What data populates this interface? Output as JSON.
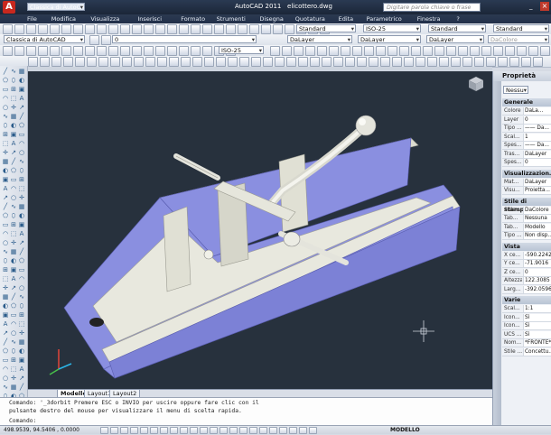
{
  "app": {
    "workspace": "Classica di AutoCAD",
    "title": "AutoCAD 2011",
    "filename": "elicottero.dwg",
    "search_placeholder": "Digitare parola chiave o frase"
  },
  "menu": [
    "File",
    "Modifica",
    "Visualizza",
    "Inserisci",
    "Formato",
    "Strumenti",
    "Disegna",
    "Quotatura",
    "Edita",
    "Parametrico",
    "Finestra",
    "?"
  ],
  "toolbar": {
    "style1": "Standard",
    "dimstyle": "ISO-25",
    "style2": "Standard",
    "style3": "Standard",
    "workspace": "Classica di AutoCAD",
    "layer": "0",
    "color": "DaLayer",
    "linetype": "DaLayer",
    "lineweight": "DaLayer",
    "plotstyle": "DaColore",
    "dimstyle2": "ISO-25"
  },
  "layout_tabs": [
    "Modello",
    "Layout1",
    "Layout2"
  ],
  "command": {
    "line1": "Comando: '_3dorbit Premere ESC o INVIO per uscire oppure fare clic con il",
    "line2": "pulsante destro del mouse per visualizzare il menu di scelta rapida.",
    "prompt": "Comando:"
  },
  "status": {
    "coords": "498.9539, 94.5406 , 0.0000",
    "model": "MODELLO"
  },
  "properties": {
    "title": "Proprietà",
    "selection": "Nessu",
    "sections": [
      {
        "name": "Generale",
        "rows": [
          {
            "k": "Colore",
            "v": "DaLa..."
          },
          {
            "k": "Layer",
            "v": "0"
          },
          {
            "k": "Tipo ...",
            "v": "—— Da..."
          },
          {
            "k": "Scal...",
            "v": "1"
          },
          {
            "k": "Spes...",
            "v": "—— Da..."
          },
          {
            "k": "Tras...",
            "v": "DaLayer"
          },
          {
            "k": "Spes...",
            "v": "0"
          }
        ]
      },
      {
        "name": "Visualizzazion...",
        "rows": [
          {
            "k": "Mat...",
            "v": "DaLayer"
          },
          {
            "k": "Visu...",
            "v": "Proietta..."
          }
        ]
      },
      {
        "name": "Stile di stampa",
        "rows": [
          {
            "k": "Stile ...",
            "v": "DaColore"
          },
          {
            "k": "Tab...",
            "v": "Nessuna"
          },
          {
            "k": "Tab...",
            "v": "Modello"
          },
          {
            "k": "Tipo ...",
            "v": "Non disp..."
          }
        ]
      },
      {
        "name": "Vista",
        "rows": [
          {
            "k": "X ce...",
            "v": "-590.2242"
          },
          {
            "k": "Y ce...",
            "v": "-71.9016"
          },
          {
            "k": "Z ce...",
            "v": "0"
          },
          {
            "k": "Altezza",
            "v": "122.3085"
          },
          {
            "k": "Larg...",
            "v": "-392.0596"
          }
        ]
      },
      {
        "name": "Varie",
        "rows": [
          {
            "k": "Scal...",
            "v": "1:1"
          },
          {
            "k": "Icon...",
            "v": "Sì"
          },
          {
            "k": "Icon...",
            "v": "Sì"
          },
          {
            "k": "UCS ...",
            "v": "Sì"
          },
          {
            "k": "Nom...",
            "v": "*FRONTE*"
          },
          {
            "k": "Stile ...",
            "v": "Concettu..."
          }
        ]
      }
    ]
  },
  "colors": {
    "viewport_bg": "#27313d",
    "part_face": "#8a8fe0",
    "part_body": "#e8e8de"
  }
}
